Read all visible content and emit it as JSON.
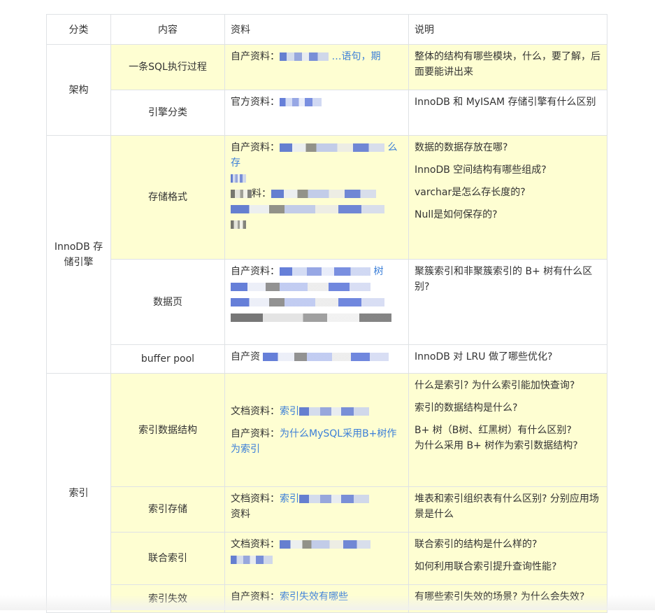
{
  "header": {
    "category": "分类",
    "topic": "内容",
    "resource": "资料",
    "description": "说明"
  },
  "rows": [
    {
      "category": "架构",
      "topic": "一条SQL执行过程",
      "resource_label": "自产资料：",
      "resource_link": "…语句，期",
      "desc": [
        "整体的结构有哪些模块，什么，要了解，后面要能讲出来"
      ]
    },
    {
      "topic": "引擎分类",
      "resource_label": "官方资料：",
      "resource_link": "",
      "desc": [
        "InnoDB 和 MyISAM 存储引擎有什么区别"
      ]
    },
    {
      "category": "InnoDB 存储引擎",
      "topic": "存储格式",
      "resource_label": "自产资料：",
      "resource_link": "么存",
      "resource_label2": "料：",
      "resource_link2": "",
      "desc": [
        "数据的数据存放在哪?",
        "InnoDB 空间结构有哪些组成?",
        "varchar是怎么存长度的?",
        "Null是如何保存的?"
      ]
    },
    {
      "topic": "数据页",
      "resource_label": "自产资料：",
      "resource_link": "树",
      "desc": [
        "聚簇索引和非聚簇索引的 B+ 树有什么区别?"
      ]
    },
    {
      "topic": "buffer pool",
      "resource_label": "自产资",
      "resource_link": "",
      "desc": [
        "InnoDB 对 LRU 做了哪些优化?"
      ]
    },
    {
      "category": "索引",
      "topic": "索引数据结构",
      "resource_label": "文档资料：",
      "resource_link": "索引",
      "resource_label2": "自产资料：",
      "resource_link2": "为什么MySQL采用B+树作为索引",
      "desc": [
        "什么是索引? 为什么索引能加快查询?",
        "索引的数据结构是什么?",
        "B+ 树（B树、红黑树）有什么区别?",
        "为什么采用 B+ 树作为索引数据结构?"
      ]
    },
    {
      "topic": "索引存储",
      "resource_label": "文档资料：",
      "resource_link": "索引",
      "resource_tail": "资料",
      "desc": [
        "堆表和索引组织表有什么区别? 分别应用场景是什么"
      ]
    },
    {
      "topic": "联合索引",
      "resource_label": "文档资料：",
      "resource_link": "",
      "desc": [
        "联合索引的结构是什么样的?",
        "如何利用联合索引提升查询性能?"
      ]
    },
    {
      "topic": "索引失效",
      "resource_label": "自产资料：",
      "resource_link": "索引失效有哪些",
      "desc": [
        "有哪些索引失效的场景? 为什么会失效?"
      ]
    }
  ]
}
